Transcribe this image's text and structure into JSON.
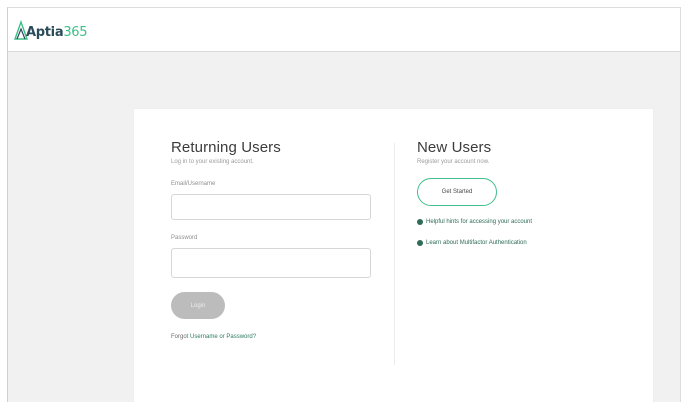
{
  "brand": {
    "word": "Aptia",
    "number": "365",
    "icon": "mountain-logo-icon",
    "color_word": "#2b4b5a",
    "color_accent": "#3dbf86"
  },
  "returning": {
    "title": "Returning Users",
    "subtitle": "Log in to your existing account.",
    "username_label": "Email/Username",
    "username_value": "",
    "password_label": "Password",
    "password_value": "",
    "login_label": "Login",
    "forgot_prefix": "Forgot ",
    "forgot_link": "Username or Password?"
  },
  "new_users": {
    "title": "New Users",
    "subtitle": "Register your account now.",
    "get_started_label": "Get Started",
    "links": [
      {
        "icon": "circle-bullet-icon",
        "label": "Helpful hints for accessing your account"
      },
      {
        "icon": "circle-bullet-icon",
        "label": "Learn about Multifactor Authentication"
      }
    ]
  },
  "colors": {
    "accent_green": "#3fbf8a",
    "link_green": "#2e6b58",
    "button_disabled": "#bcbcbc",
    "page_bg": "#f1f1f1"
  }
}
